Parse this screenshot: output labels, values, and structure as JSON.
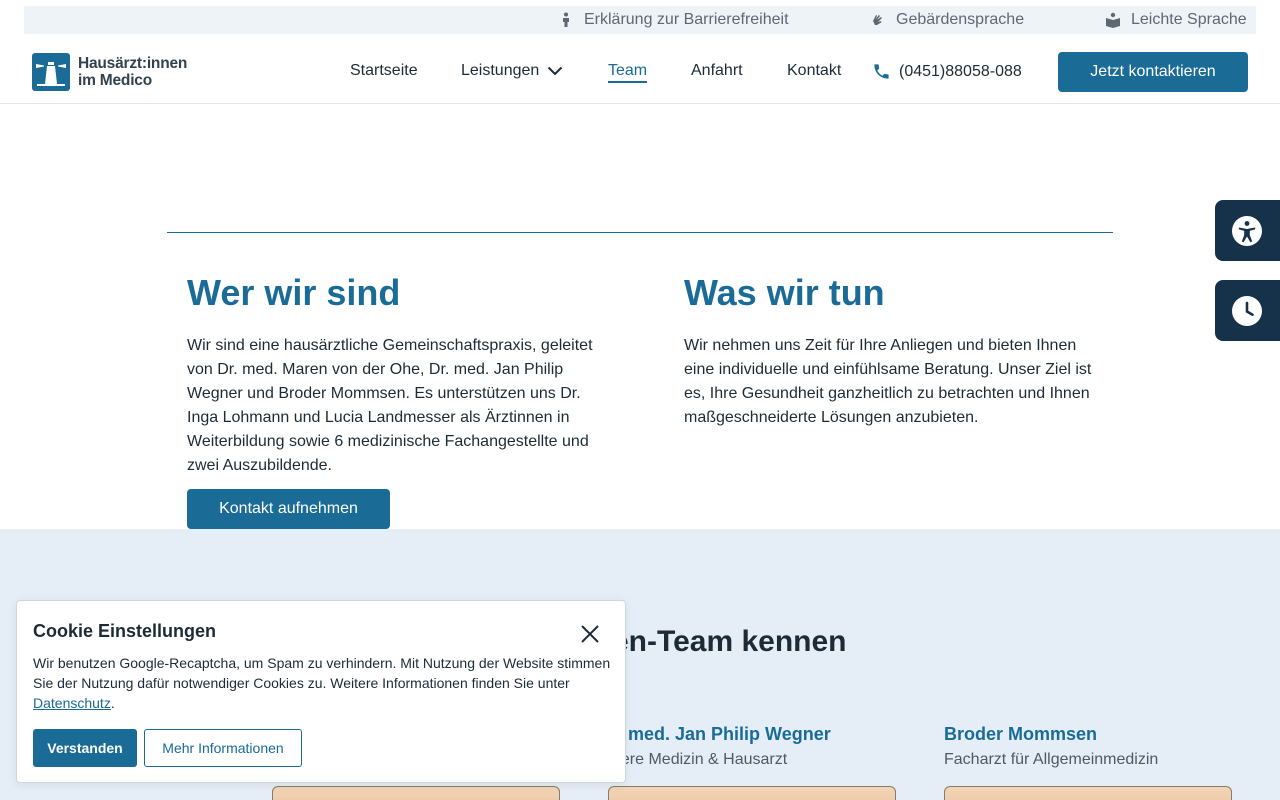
{
  "utility": {
    "accessibility": "Erklärung zur Barrierefreiheit",
    "sign_language": "Gebärdensprache",
    "easy_language": "Leichte Sprache"
  },
  "header": {
    "logo_line1": "Hausärzt:innen",
    "logo_line2": "im Medico",
    "nav": [
      "Startseite",
      "Leistungen",
      "Team",
      "Anfahrt",
      "Kontakt"
    ],
    "active_nav": "Team",
    "phone": "(0451)88058-088",
    "cta": "Jetzt kontaktieren"
  },
  "side_tabs": {
    "accessibility_icon": "accessibility-icon",
    "hours_icon": "clock-icon"
  },
  "intro": {
    "who": {
      "title": "Wer wir sind",
      "text": "Wir sind eine hausärztliche Gemeinschaftspraxis, geleitet von Dr. med. Maren von der Ohe, Dr. med. Jan Philip Wegner und Broder Mommsen. Es unterstützen uns Dr. Inga Lohmann und Lucia Landmesser als Ärztinnen in Weiterbildung sowie 6 medizinische Fachangestellte und zwei Auszubildende."
    },
    "what": {
      "title": "Was wir tun",
      "text": "Wir nehmen uns Zeit für Ihre Anliegen und bieten Ihnen eine individuelle und einfühlsame Beratung. Unser Ziel ist es, Ihre Gesundheit ganzheitlich zu betrachten und Ihnen maßgeschneiderte Lösungen anzubieten."
    },
    "button": "Kontakt aufnehmen"
  },
  "team": {
    "heading_visible": "en-Team kennen",
    "members": [
      {
        "name": "r. med. Jan Philip Wegner",
        "role": "nere Medizin & Hausarzt"
      },
      {
        "name": "Broder Mommsen",
        "role": "Facharzt für Allgemeinmedizin"
      }
    ]
  },
  "cookie": {
    "title": "Cookie Einstellungen",
    "text": "Wir benutzen Google-Recaptcha, um Spam zu verhindern. Mit Nutzung der Website stimmen Sie der Nutzung dafür notwendiger Cookies zu. Weitere Informationen finden Sie unter ",
    "link": "Datenschutz",
    "text_end": ".",
    "accept": "Verstanden",
    "more": "Mehr Informationen"
  },
  "colors": {
    "brand": "#1a6b96",
    "dark": "#16324a",
    "section_bg": "#e5eef7"
  }
}
